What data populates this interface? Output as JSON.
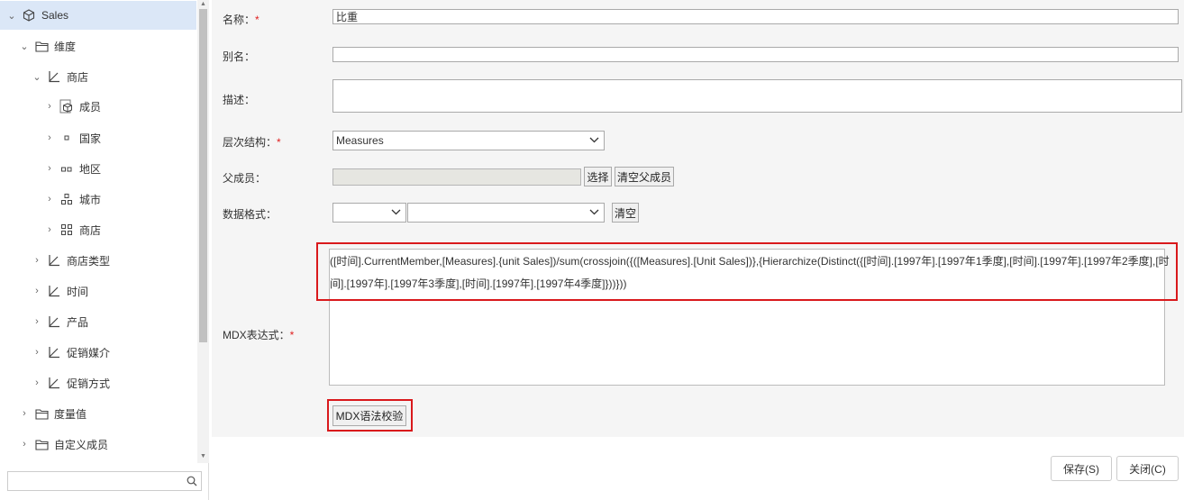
{
  "tree": {
    "items": [
      {
        "label": "Sales",
        "toggle": "⌄",
        "icon": "cube-icon",
        "selected": true
      },
      {
        "label": "维度",
        "toggle": "⌄",
        "icon": "folder-icon"
      },
      {
        "label": "商店",
        "toggle": "⌄",
        "icon": "hierarchy-icon"
      },
      {
        "label": "成员",
        "toggle": "›",
        "icon": "members-icon"
      },
      {
        "label": "国家",
        "toggle": "›",
        "icon": "level-1-icon"
      },
      {
        "label": "地区",
        "toggle": "›",
        "icon": "level-2-icon"
      },
      {
        "label": "城市",
        "toggle": "›",
        "icon": "level-3-icon"
      },
      {
        "label": "商店",
        "toggle": "›",
        "icon": "level-4-icon"
      },
      {
        "label": "商店类型",
        "toggle": "›",
        "icon": "hierarchy-icon"
      },
      {
        "label": "时间",
        "toggle": "›",
        "icon": "hierarchy-icon"
      },
      {
        "label": "产品",
        "toggle": "›",
        "icon": "hierarchy-icon"
      },
      {
        "label": "促销媒介",
        "toggle": "›",
        "icon": "hierarchy-icon"
      },
      {
        "label": "促销方式",
        "toggle": "›",
        "icon": "hierarchy-icon"
      },
      {
        "label": "度量值",
        "toggle": "›",
        "icon": "folder-icon"
      },
      {
        "label": "自定义成员",
        "toggle": "›",
        "icon": "folder-icon"
      }
    ],
    "search_placeholder": ""
  },
  "form": {
    "name_label": "名称：",
    "name_value": "比重",
    "alias_label": "别名：",
    "alias_value": "",
    "desc_label": "描述：",
    "desc_value": "",
    "hierarchy_label": "层次结构：",
    "hierarchy_value": "Measures",
    "parent_label": "父成员：",
    "parent_value": "",
    "choose_button": "选择",
    "clear_parent_button": "清空父成员",
    "format_label": "数据格式：",
    "format_value_1": "",
    "format_value_2": "",
    "clear_button": "清空",
    "mdx_label": "MDX表达式：",
    "mdx_value": "([时间].CurrentMember,[Measures].{unit Sales])/sum(crossjoin({([Measures].[Unit Sales])},{Hierarchize(Distinct({[时间].[1997年].[1997年1季度],[时间].[1997年].[1997年2季度],[时间].[1997年].[1997年3季度],[时间].[1997年].[1997年4季度]}))}))",
    "mdx_check_button": "MDX语法校验",
    "required_mark": "*"
  },
  "footer": {
    "save_button": "保存(S)",
    "close_button": "关闭(C)"
  },
  "colors": {
    "selected_row": "#dbe7f7",
    "highlight_border": "#d9191c",
    "required": "#e02020"
  }
}
